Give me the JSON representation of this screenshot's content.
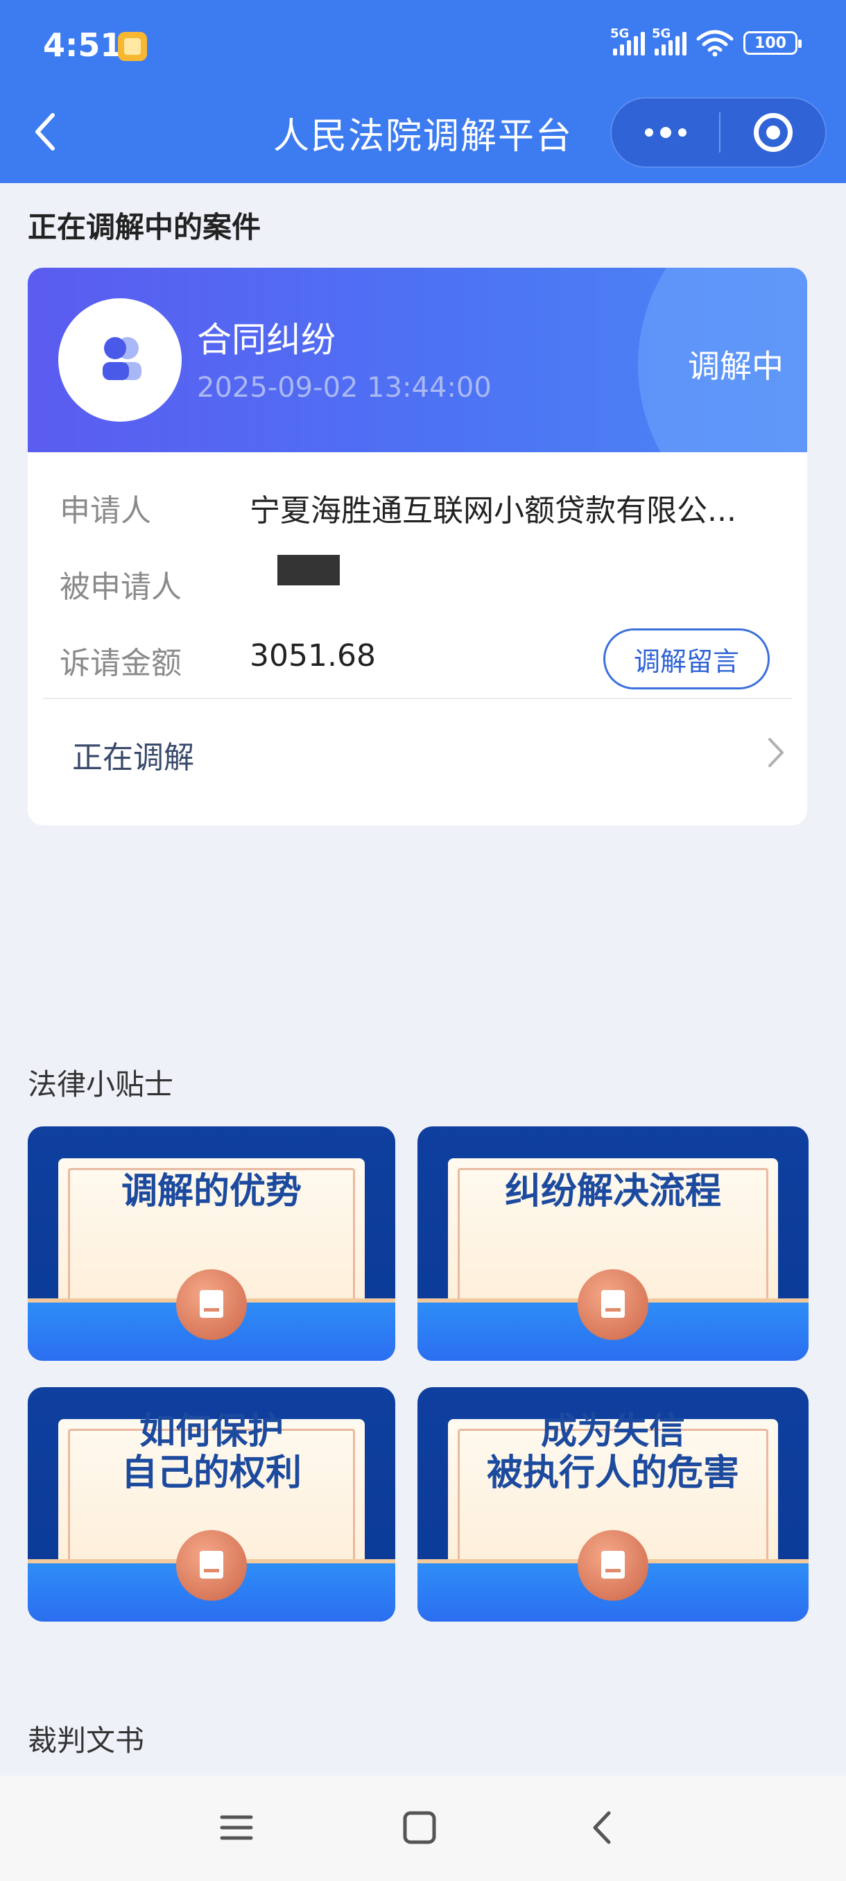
{
  "status_bar": {
    "time": "4:51",
    "signal_1": "5G",
    "signal_2": "5G",
    "battery": "100"
  },
  "nav": {
    "title": "人民法院调解平台"
  },
  "ongoing_section": {
    "title": "正在调解中的案件"
  },
  "case": {
    "type": "合同纠纷",
    "time": "2025-09-02 13:44:00",
    "status": "调解中",
    "applicant_label": "申请人",
    "applicant_value": "宁夏海胜通互联网小额贷款有限公...",
    "respondent_label": "被申请人",
    "amount_label": "诉请金额",
    "amount_value": "3051.68",
    "message_button": "调解留言",
    "progress_label": "正在调解"
  },
  "tips_section": {
    "title": "法律小贴士",
    "items": [
      {
        "label": "调解的优势"
      },
      {
        "label": "纠纷解决流程"
      },
      {
        "label": "如何保护\n自己的权利"
      },
      {
        "label": "成为失信\n被执行人的危害"
      }
    ]
  },
  "documents_section": {
    "title": "裁判文书"
  },
  "colors": {
    "primary": "#3d7bf1",
    "case_header": "#5b5cf0",
    "tip_dark": "#0f3f9f",
    "tip_text": "#1c4a9e"
  }
}
